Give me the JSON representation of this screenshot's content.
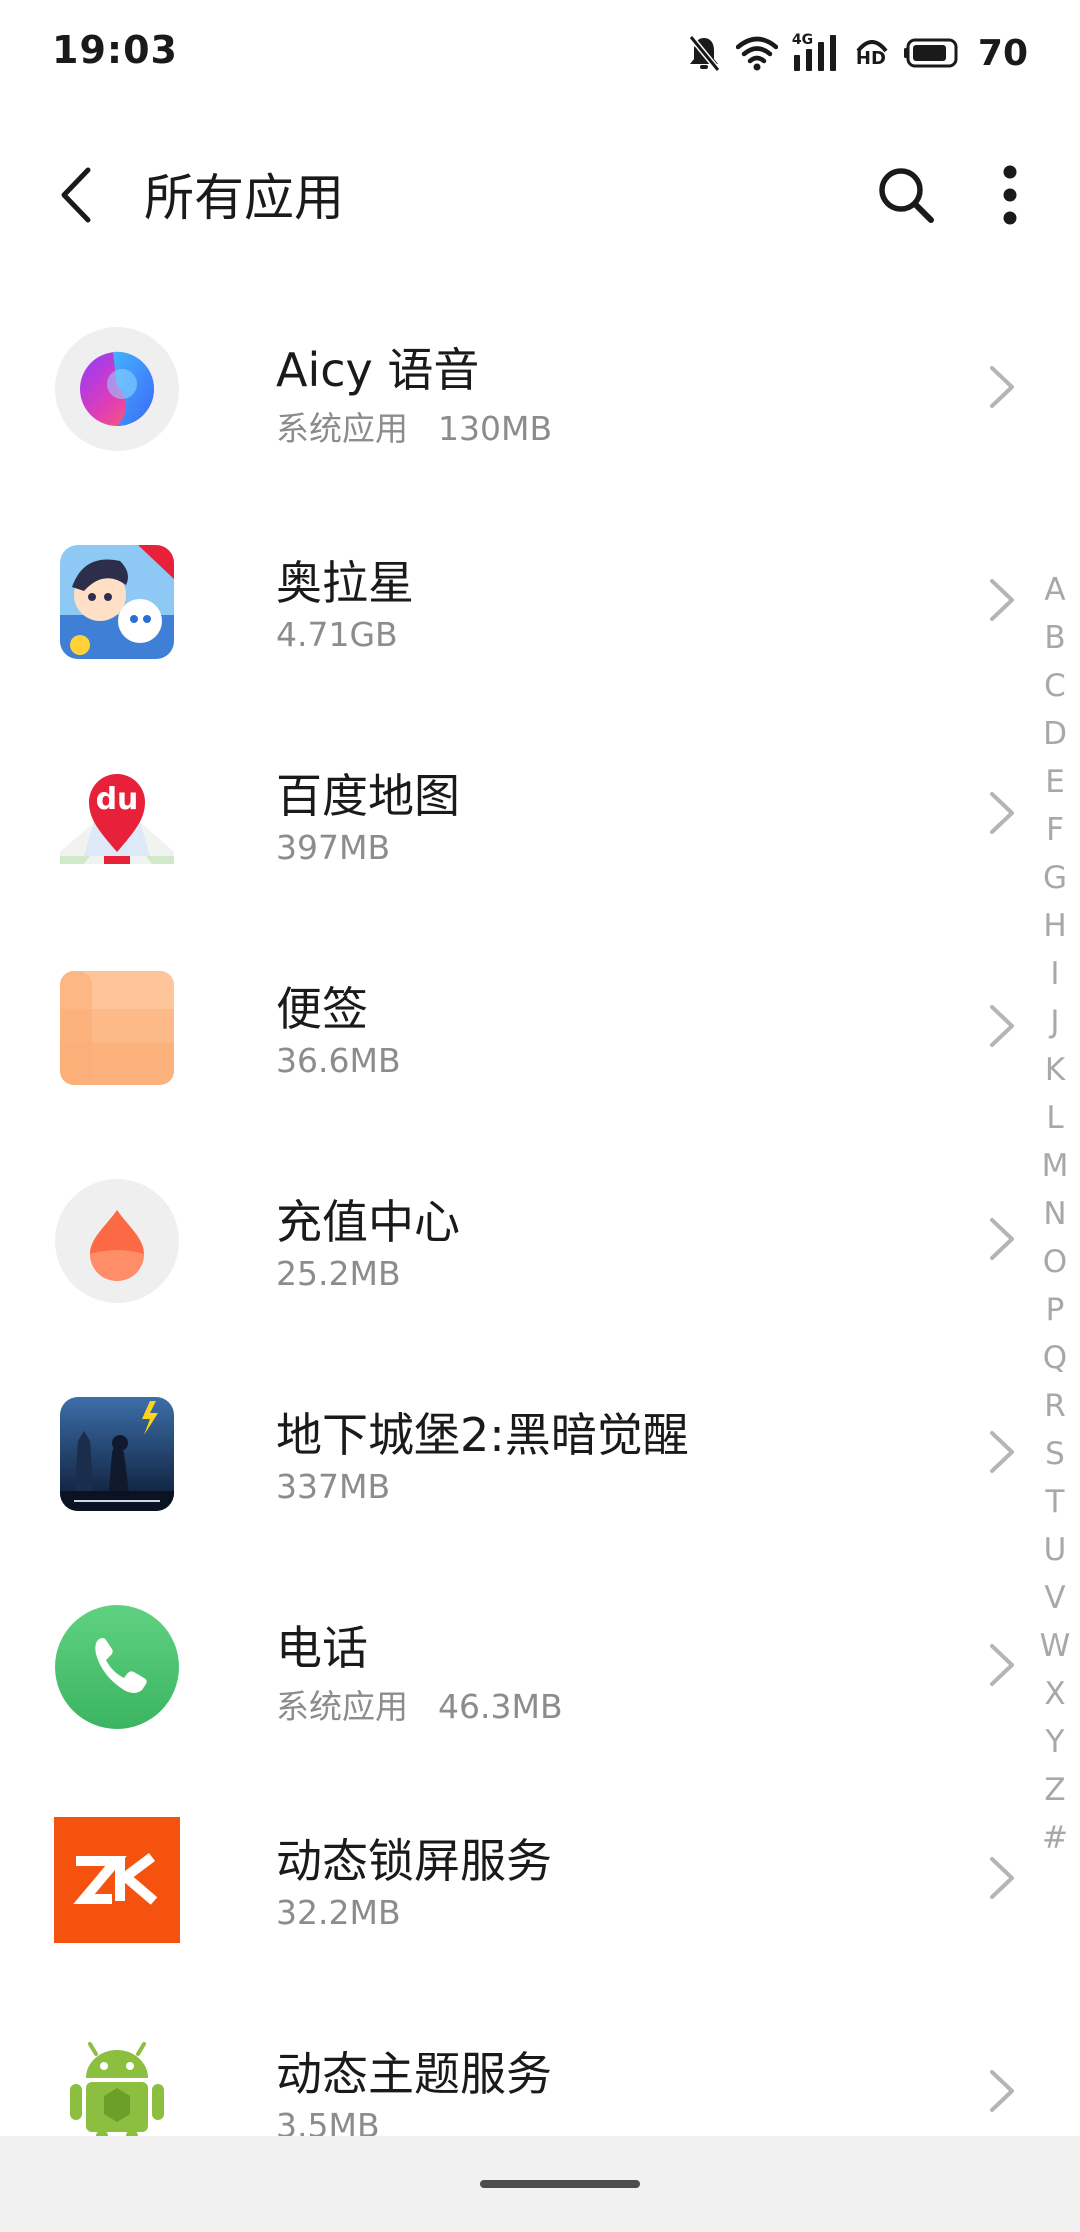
{
  "status_bar": {
    "time": "19:03",
    "network_label": "4G",
    "hd_label": "HD",
    "battery_level": "70",
    "icons": [
      "mute-icon",
      "wifi-icon",
      "signal-icon",
      "hd-icon",
      "battery-icon"
    ]
  },
  "header": {
    "title": "所有应用",
    "icons": [
      "back-icon",
      "search-icon",
      "more-vert-icon"
    ]
  },
  "apps": [
    {
      "name": "Aicy 语音",
      "tag": "系统应用",
      "size": "130MB",
      "icon": "aicy-voice-icon"
    },
    {
      "name": "奥拉星",
      "tag": "",
      "size": "4.71GB",
      "icon": "aola-star-icon"
    },
    {
      "name": "百度地图",
      "tag": "",
      "size": "397MB",
      "icon": "baidu-maps-icon",
      "icon_text": "du"
    },
    {
      "name": "便签",
      "tag": "",
      "size": "36.6MB",
      "icon": "notes-icon"
    },
    {
      "name": "充值中心",
      "tag": "",
      "size": "25.2MB",
      "icon": "recharge-center-icon"
    },
    {
      "name": "地下城堡2:黑暗觉醒",
      "tag": "",
      "size": "337MB",
      "icon": "dungeon-castle-icon"
    },
    {
      "name": "电话",
      "tag": "系统应用",
      "size": "46.3MB",
      "icon": "phone-icon"
    },
    {
      "name": "动态锁屏服务",
      "tag": "",
      "size": "32.2MB",
      "icon": "dynamic-lockscreen-icon"
    },
    {
      "name": "动态主题服务",
      "tag": "",
      "size": "3.5MB",
      "icon": "dynamic-theme-icon"
    }
  ],
  "alphabet_index": [
    "A",
    "B",
    "C",
    "D",
    "E",
    "F",
    "G",
    "H",
    "I",
    "J",
    "K",
    "L",
    "M",
    "N",
    "O",
    "P",
    "Q",
    "R",
    "S",
    "T",
    "U",
    "V",
    "W",
    "X",
    "Y",
    "Z",
    "#"
  ],
  "colors": {
    "text_primary": "#1a1a1a",
    "text_secondary": "#8c8c8c",
    "index_text": "#a8a8a8",
    "phone_green": "#4cc46f",
    "lockscreen_orange": "#f5520f",
    "notes_orange": "#fdb27e"
  }
}
